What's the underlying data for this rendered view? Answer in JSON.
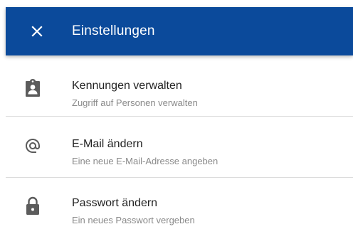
{
  "header": {
    "title": "Einstellungen",
    "close_icon": "close-icon",
    "background_color": "#0b4a9b"
  },
  "settings": {
    "items": [
      {
        "title": "Kennungen verwalten",
        "subtitle": "Zugriff auf Personen verwalten",
        "icon": "badge-icon"
      },
      {
        "title": "E-Mail ändern",
        "subtitle": "Eine neue E-Mail-Adresse angeben",
        "icon": "at-sign-icon"
      },
      {
        "title": "Passwort ändern",
        "subtitle": "Ein neues Passwort vergeben",
        "icon": "lock-icon"
      }
    ]
  }
}
